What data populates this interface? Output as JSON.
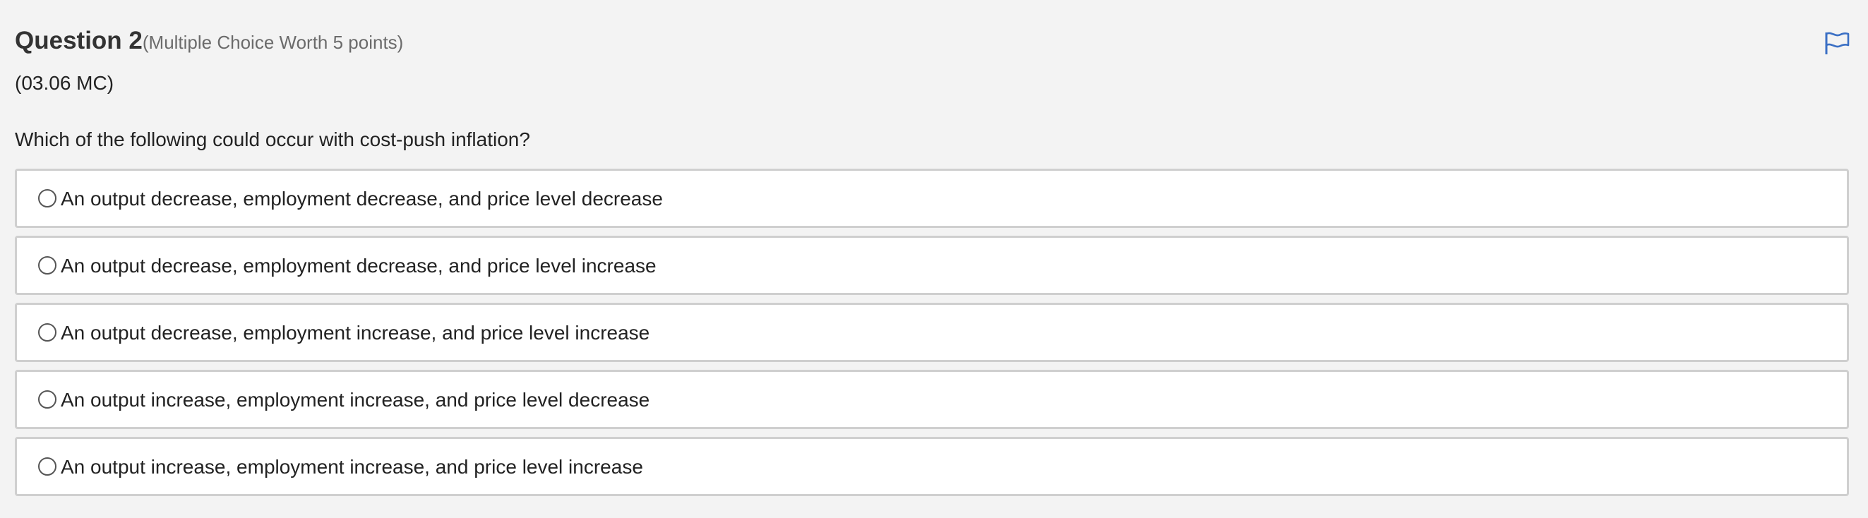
{
  "question": {
    "title": "Question 2",
    "points": "(Multiple Choice Worth 5 points)",
    "code": "(03.06 MC)",
    "prompt": "Which of the following could occur with cost-push inflation?",
    "flag_icon": "flag-icon",
    "accent_color": "#3a6fc4"
  },
  "options": [
    {
      "label": "An output decrease, employment decrease, and price level decrease"
    },
    {
      "label": "An output decrease, employment decrease, and price level increase"
    },
    {
      "label": "An output decrease, employment increase, and price level increase"
    },
    {
      "label": "An output increase, employment increase, and price level decrease"
    },
    {
      "label": "An output increase, employment increase, and price level increase"
    }
  ]
}
